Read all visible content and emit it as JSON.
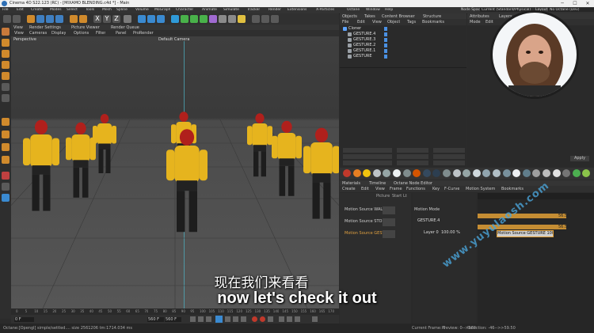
{
  "window": {
    "title": "Cinema 4D S22.123 (RC) - [MIXAMO BLENDING.c4d *] - Main",
    "controls": [
      "─",
      "☐",
      "✕"
    ]
  },
  "menubar": {
    "items": [
      "File",
      "Edit",
      "Create",
      "Modes",
      "Select",
      "Tools",
      "Mesh",
      "Spline",
      "Volume",
      "MoGraph",
      "Character",
      "Animate",
      "Simulate",
      "Tracker",
      "Render",
      "Extensions",
      "X-Particles",
      "Octane",
      "Window",
      "Help"
    ],
    "node_space_label": "Node Space:",
    "node_space_value": "Current (Standard/Physical)",
    "layout_label": "Layout:",
    "layout_value": "No Octane (Dev)"
  },
  "viewport": {
    "tabs": [
      "View",
      "Render Settings",
      "Picture Viewer",
      "Render Queue"
    ],
    "menu": [
      "View",
      "Cameras",
      "Display",
      "Options",
      "Filter",
      "Panel",
      "ProRender"
    ],
    "projection": "Perspective",
    "camera": "Default Camera"
  },
  "timeline_ruler": {
    "ticks": [
      "0",
      "5",
      "10",
      "15",
      "20",
      "25",
      "30",
      "35",
      "40",
      "45",
      "50",
      "55",
      "60",
      "65",
      "70",
      "75",
      "80",
      "85",
      "90",
      "95",
      "100",
      "105",
      "110",
      "115",
      "120",
      "125",
      "130",
      "135",
      "140",
      "145",
      "150",
      "155",
      "160",
      "165",
      "170"
    ],
    "current_frame": "0 F"
  },
  "transport": {
    "start": "0 F",
    "end_a": "560 F",
    "end_b": "560 F",
    "fields": [
      "0 F",
      "0 F"
    ]
  },
  "statusbar": {
    "left": "Octane:[Opengl] simple/settled.... size 2561206 tm:1714.034 ms",
    "right_frame": "Current Frame: 0",
    "right_preview": "Preview: 0-->560",
    "right_selection": "Selection: -46-->>59.50"
  },
  "object_manager": {
    "tabs": [
      "Objects",
      "Takes",
      "Content Browser",
      "Structure"
    ],
    "menu": [
      "File",
      "Edit",
      "View",
      "Object",
      "Tags",
      "Bookmarks"
    ],
    "items": [
      {
        "name": "Cloner",
        "color": "#5ea4ff"
      },
      {
        "name": "GESTURE.4",
        "color": "#9aa0a6"
      },
      {
        "name": "GESTURE.3",
        "color": "#9aa0a6"
      },
      {
        "name": "GESTURE.2",
        "color": "#9aa0a6"
      },
      {
        "name": "GESTURE.1",
        "color": "#9aa0a6"
      },
      {
        "name": "GESTURE",
        "color": "#9aa0a6"
      }
    ]
  },
  "attributes": {
    "tabs": [
      "Attributes",
      "Layers",
      "Key Frames"
    ],
    "menu": [
      "Mode",
      "Edit"
    ],
    "apply_label": "Apply"
  },
  "motion_panel": {
    "tabs": [
      "Materials",
      "Timeline",
      "Octane Node Editor"
    ],
    "menu": [
      "Create",
      "Edit",
      "View",
      "Frame",
      "Functions",
      "Key",
      "F-Curve",
      "Motion System",
      "Bookmarks"
    ],
    "header_cols": [
      "Picture",
      "Start",
      "Lt"
    ],
    "mode_label": "Motion Mode",
    "clips": [
      "Motion Source WALK",
      "Motion Source STOP",
      "Motion Source GESTURE"
    ],
    "tracks": [
      {
        "name": "GESTURE.4",
        "value": ""
      },
      {
        "name": "Layer 0",
        "value": "100.00 %"
      }
    ],
    "clip_label": "Motion Source GESTURE 100.00%",
    "bar_values": [
      "56.50",
      "56.50"
    ]
  },
  "material_swatches": [
    "#c0392b",
    "#e67e22",
    "#f1c40f",
    "#bdc3c7",
    "#95a5a6",
    "#ecf0f1",
    "#7f8c8d",
    "#d35400",
    "#34495e",
    "#2c3e50",
    "#7f8c8d",
    "#bdc3c7",
    "#95a5a6",
    "#cfd8dc",
    "#90a4ae",
    "#b0bec5",
    "#78909c",
    "#eceff1",
    "#607d8b",
    "#9e9e9e",
    "#bdbdbd",
    "#e0e0e0",
    "#757575",
    "#4caf50",
    "#8bc34a"
  ],
  "subtitles": {
    "chinese": "现在我们来看看",
    "english": "now let's check it out"
  },
  "watermark": "www.yuyulaosh.com"
}
